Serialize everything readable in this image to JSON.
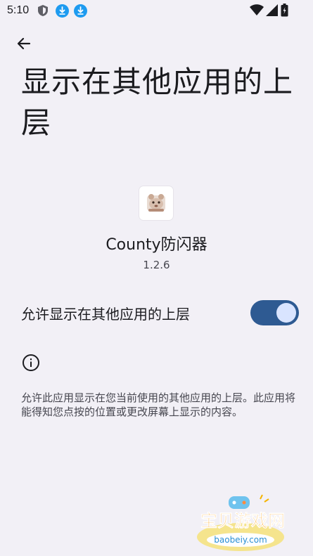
{
  "status_bar": {
    "time": "5:10",
    "icons": [
      "shield-icon",
      "download-icon",
      "download-icon",
      "wifi-icon",
      "cellular-signal-icon",
      "battery-icon"
    ]
  },
  "header": {
    "back_icon": "arrow-left-icon",
    "title": "显示在其他应用的上层"
  },
  "app": {
    "name": "County防闪器",
    "version": "1.2.6"
  },
  "permission": {
    "label": "允许显示在其他应用的上层",
    "enabled": true
  },
  "info": {
    "icon": "info-icon",
    "description": "允许此应用显示在您当前使用的其他应用的上层。此应用将能得知您点按的位置或更改屏幕上显示的内容。"
  },
  "watermark": {
    "title": "宝贝游戏网",
    "domain": "baobeiy.com"
  },
  "colors": {
    "background": "#f2f0f6",
    "toggle_track": "#2e5a92",
    "toggle_thumb": "#d9e4ff",
    "download_badge": "#1e9bf0"
  }
}
